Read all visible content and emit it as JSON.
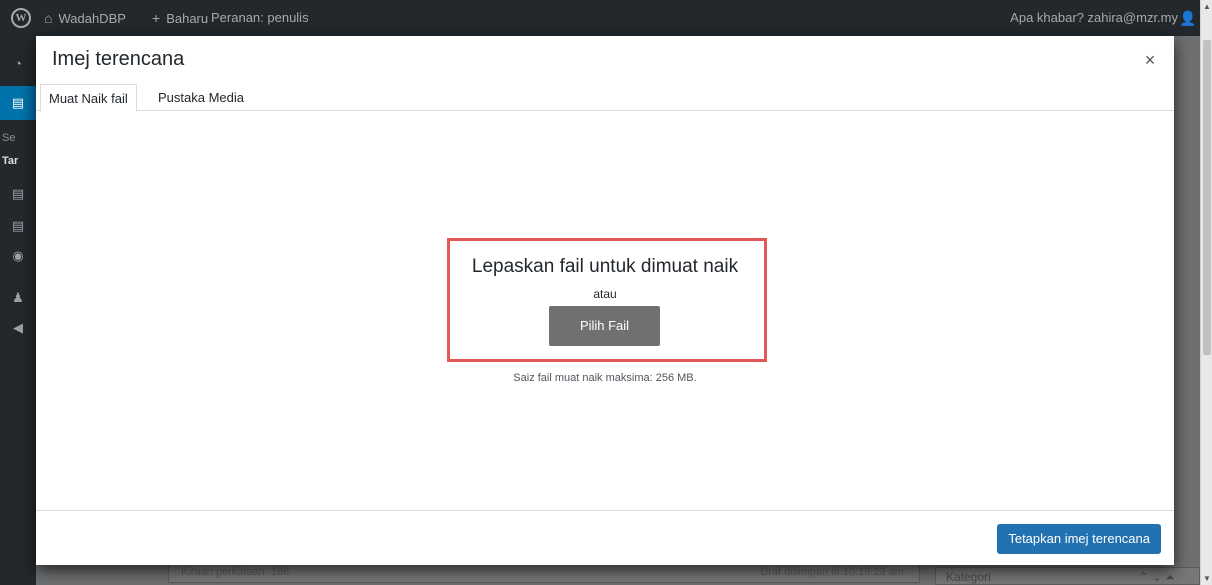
{
  "adminbar": {
    "logo": "W",
    "site_name": "WadahDBP",
    "new_label": "Baharu",
    "role_label": "Peranan: penulis",
    "greeting": "Apa khabar? zahira@mzr.my"
  },
  "sidebar_fragments": [
    "Se",
    "Tar"
  ],
  "modal": {
    "title": "Imej terencana",
    "close_glyph": "×",
    "tabs": [
      {
        "label": "Muat Naik fail",
        "active": true
      },
      {
        "label": "Pustaka Media",
        "active": false
      }
    ],
    "upload": {
      "drop_instructions": "Lepaskan fail untuk dimuat naik",
      "or": "atau",
      "select_button": "Pilih Fail",
      "max_size": "Saiz fail muat naik maksima: 256 MB."
    },
    "footer": {
      "set_button": "Tetapkan imej terencana"
    }
  },
  "background": {
    "word_count": "Kiraan perkataan: 186",
    "draft_saved": "Draf disimpan di 10:19:23 am.",
    "category_box": "Kategori"
  },
  "colors": {
    "admin_bar": "#23282d",
    "menu_active": "#0073aa",
    "primary_button": "#2271b1",
    "highlight_box": "#e05858",
    "select_button": "#707070"
  }
}
